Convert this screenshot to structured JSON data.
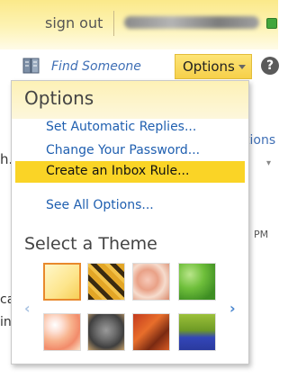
{
  "header": {
    "signout_label": "sign out"
  },
  "toolbar": {
    "find_someone_label": "Find Someone",
    "options_label": "Options"
  },
  "background": {
    "fragment_h": "h...",
    "fragment_tions": "tions",
    "fragment_pm": "PM",
    "fragment_ca": "ca",
    "fragment_in": "in"
  },
  "menu": {
    "title": "Options",
    "items": [
      {
        "label": "Set Automatic Replies..."
      },
      {
        "label": "Change Your Password..."
      },
      {
        "label": "Create an Inbox Rule..."
      },
      {
        "label": "See All Options..."
      }
    ],
    "theme_title": "Select a Theme",
    "themes": [
      {
        "name": "pale-yellow-theme",
        "selected": true
      },
      {
        "name": "tiger-theme",
        "selected": false
      },
      {
        "name": "floral-pink-theme",
        "selected": false
      },
      {
        "name": "green-leaves-theme",
        "selected": false
      },
      {
        "name": "bubbles-theme",
        "selected": false
      },
      {
        "name": "robot-theme",
        "selected": false
      },
      {
        "name": "autumn-leaves-theme",
        "selected": false
      },
      {
        "name": "cartoon-creature-theme",
        "selected": false
      }
    ]
  },
  "colors": {
    "accent_yellow": "#fad426",
    "link_blue": "#1f5fb0",
    "selected_border": "#e8892c"
  }
}
